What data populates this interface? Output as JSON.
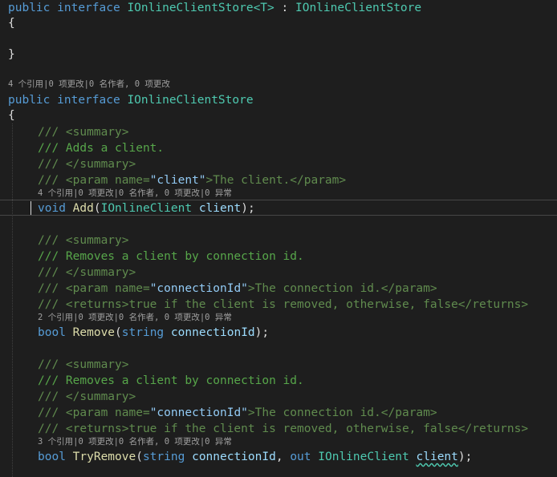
{
  "code": {
    "iface1": {
      "kw_public": "public",
      "kw_interface": "interface",
      "name": "IOnlineClientStore",
      "generic": "<T>",
      "colon": " : ",
      "base": "IOnlineClientStore",
      "open_brace": "{",
      "close_brace": "}"
    },
    "iface2": {
      "lens": "4 个引用|0 项更改|0 名作者, 0 项更改",
      "kw_public": "public",
      "kw_interface": "interface",
      "name": "IOnlineClientStore",
      "open_brace": "{"
    },
    "add": {
      "doc1": "/// <summary>",
      "doc2": "/// Adds a client.",
      "doc3": "/// </summary>",
      "doc4_a": "/// <param name=",
      "doc4_b": "\"client\"",
      "doc4_c": ">The client.</param>",
      "lens": "4 个引用|0 项更改|0 名作者, 0 项更改|0 异常",
      "ret": "void",
      "name": "Add",
      "open": "(",
      "ptype": "IOnlineClient",
      "pname": "client",
      "close": ");"
    },
    "remove": {
      "doc1": "/// <summary>",
      "doc2": "/// Removes a client by connection id.",
      "doc3": "/// </summary>",
      "doc4_a": "/// <param name=",
      "doc4_b": "\"connectionId\"",
      "doc4_c": ">The connection id.</param>",
      "doc5": "/// <returns>true if the client is removed, otherwise, false</returns>",
      "lens": "2 个引用|0 项更改|0 名作者, 0 项更改|0 异常",
      "ret": "bool",
      "name": "Remove",
      "open": "(",
      "ptype": "string",
      "pname": "connectionId",
      "close": ");"
    },
    "tryremove": {
      "doc1": "/// <summary>",
      "doc2": "/// Removes a client by connection id.",
      "doc3": "/// </summary>",
      "doc4_a": "/// <param name=",
      "doc4_b": "\"connectionId\"",
      "doc4_c": ">The connection id.</param>",
      "doc5": "/// <returns>true if the client is removed, otherwise, false</returns>",
      "lens": "3 个引用|0 项更改|0 名作者, 0 项更改|0 异常",
      "ret": "bool",
      "name": "TryRemove",
      "open": "(",
      "ptype1": "string",
      "pname1": "connectionId",
      "comma": ", ",
      "kw_out": "out",
      "ptype2": "IOnlineClient",
      "pname2": "client",
      "close": ");"
    }
  }
}
